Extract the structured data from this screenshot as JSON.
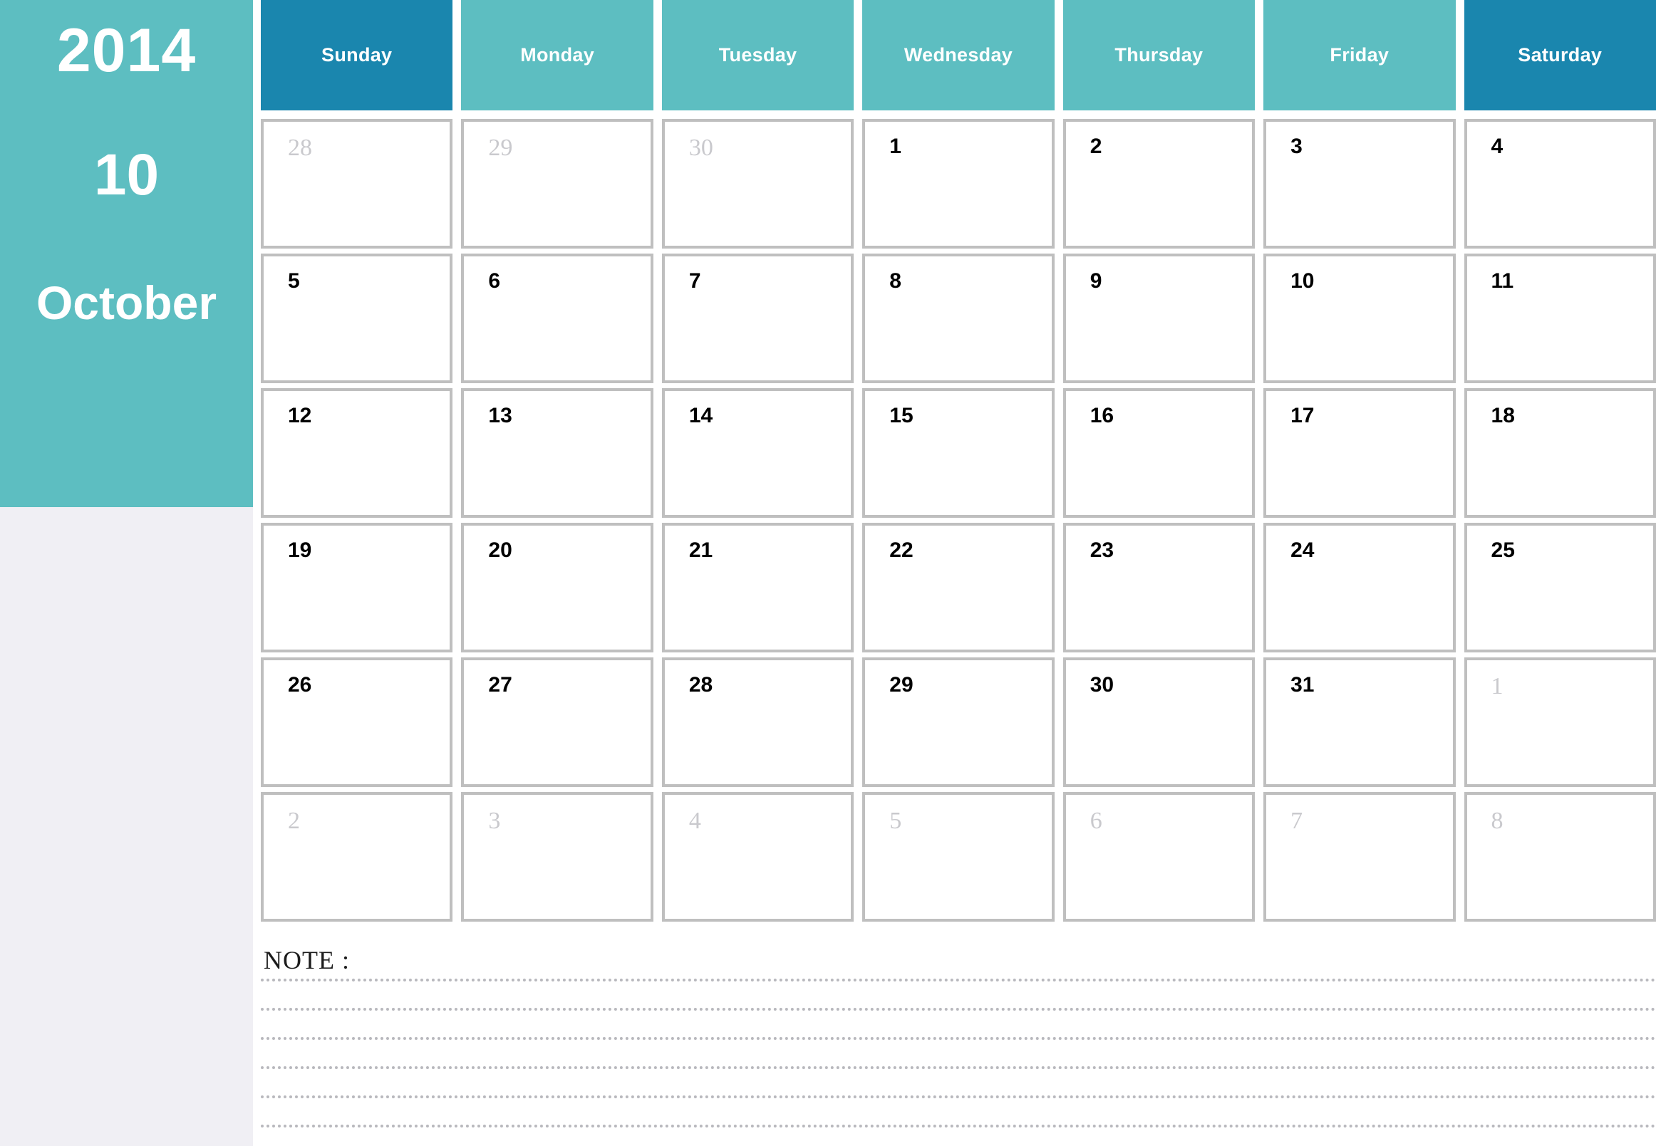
{
  "sidebar": {
    "year": "2014",
    "month_number": "10",
    "month_name": "October"
  },
  "colors": {
    "teal": "#5dbec1",
    "blue": "#1a86ae",
    "panel_gray": "#f0eff4",
    "cell_border": "#bfbfbf",
    "out_of_month_text": "#c9c9cd",
    "in_month_text": "#000000"
  },
  "weekdays": [
    {
      "label": "Sunday",
      "weekend": true
    },
    {
      "label": "Monday",
      "weekend": false
    },
    {
      "label": "Tuesday",
      "weekend": false
    },
    {
      "label": "Wednesday",
      "weekend": false
    },
    {
      "label": "Thursday",
      "weekend": false
    },
    {
      "label": "Friday",
      "weekend": false
    },
    {
      "label": "Saturday",
      "weekend": true
    }
  ],
  "weeks": [
    [
      {
        "day": "28",
        "in_month": false
      },
      {
        "day": "29",
        "in_month": false
      },
      {
        "day": "30",
        "in_month": false
      },
      {
        "day": "1",
        "in_month": true
      },
      {
        "day": "2",
        "in_month": true
      },
      {
        "day": "3",
        "in_month": true
      },
      {
        "day": "4",
        "in_month": true
      }
    ],
    [
      {
        "day": "5",
        "in_month": true
      },
      {
        "day": "6",
        "in_month": true
      },
      {
        "day": "7",
        "in_month": true
      },
      {
        "day": "8",
        "in_month": true
      },
      {
        "day": "9",
        "in_month": true
      },
      {
        "day": "10",
        "in_month": true
      },
      {
        "day": "11",
        "in_month": true
      }
    ],
    [
      {
        "day": "12",
        "in_month": true
      },
      {
        "day": "13",
        "in_month": true
      },
      {
        "day": "14",
        "in_month": true
      },
      {
        "day": "15",
        "in_month": true
      },
      {
        "day": "16",
        "in_month": true
      },
      {
        "day": "17",
        "in_month": true
      },
      {
        "day": "18",
        "in_month": true
      }
    ],
    [
      {
        "day": "19",
        "in_month": true
      },
      {
        "day": "20",
        "in_month": true
      },
      {
        "day": "21",
        "in_month": true
      },
      {
        "day": "22",
        "in_month": true
      },
      {
        "day": "23",
        "in_month": true
      },
      {
        "day": "24",
        "in_month": true
      },
      {
        "day": "25",
        "in_month": true
      }
    ],
    [
      {
        "day": "26",
        "in_month": true
      },
      {
        "day": "27",
        "in_month": true
      },
      {
        "day": "28",
        "in_month": true
      },
      {
        "day": "29",
        "in_month": true
      },
      {
        "day": "30",
        "in_month": true
      },
      {
        "day": "31",
        "in_month": true
      },
      {
        "day": "1",
        "in_month": false
      }
    ],
    [
      {
        "day": "2",
        "in_month": false
      },
      {
        "day": "3",
        "in_month": false
      },
      {
        "day": "4",
        "in_month": false
      },
      {
        "day": "5",
        "in_month": false
      },
      {
        "day": "6",
        "in_month": false
      },
      {
        "day": "7",
        "in_month": false
      },
      {
        "day": "8",
        "in_month": false
      }
    ]
  ],
  "note": {
    "label": "NOTE :",
    "line_count": 6
  }
}
